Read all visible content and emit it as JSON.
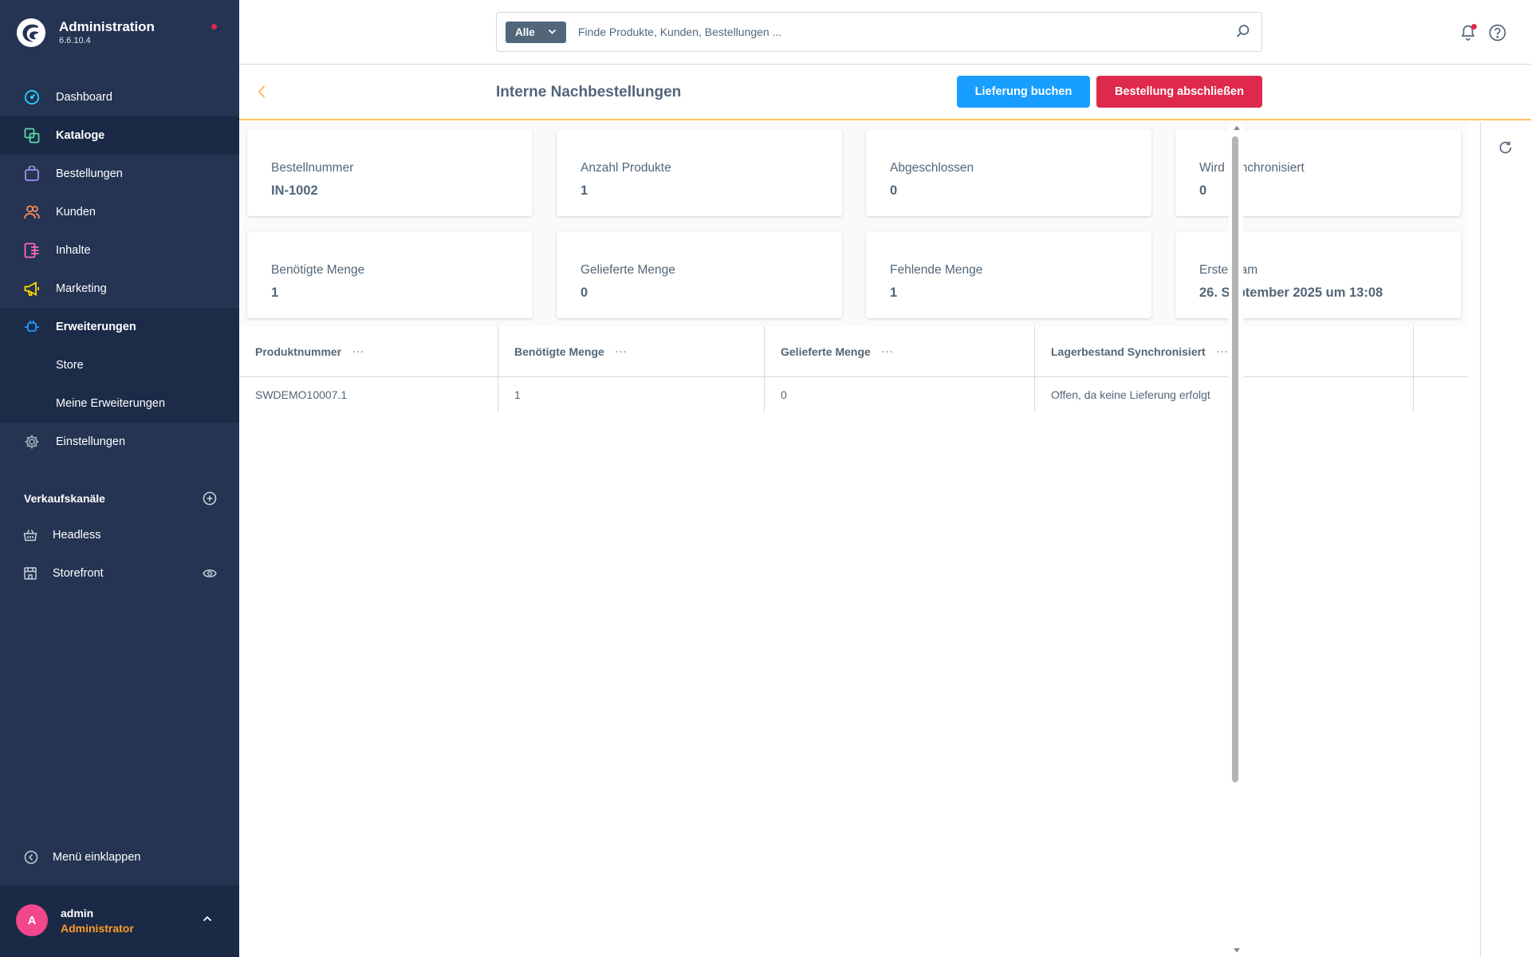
{
  "brand": {
    "title": "Administration",
    "version": "6.6.10.4"
  },
  "sidebar": {
    "items": [
      {
        "label": "Dashboard",
        "icon": "dashboard-icon",
        "color": "#26d1ff"
      },
      {
        "label": "Kataloge",
        "icon": "catalog-icon",
        "color": "#57d9a3"
      },
      {
        "label": "Bestellungen",
        "icon": "bag-icon",
        "color": "#a092f0"
      },
      {
        "label": "Kunden",
        "icon": "users-icon",
        "color": "#f88962"
      },
      {
        "label": "Inhalte",
        "icon": "content-icon",
        "color": "#ff68b4"
      },
      {
        "label": "Marketing",
        "icon": "megaphone-icon",
        "color": "#ffd700"
      },
      {
        "label": "Erweiterungen",
        "icon": "plug-icon",
        "color": "#189eff"
      },
      {
        "label": "Store"
      },
      {
        "label": "Meine Erweiterungen"
      },
      {
        "label": "Einstellungen",
        "icon": "gear-icon",
        "color": "#9aa8b5"
      }
    ],
    "channels_title": "Verkaufskanäle",
    "channels": [
      {
        "label": "Headless",
        "icon": "basket-icon"
      },
      {
        "label": "Storefront",
        "icon": "store-icon"
      }
    ],
    "collapse_label": "Menü einklappen",
    "user": {
      "initial": "A",
      "name": "admin",
      "role": "Administrator"
    }
  },
  "search": {
    "type_label": "Alle",
    "placeholder": "Finde Produkte, Kunden, Bestellungen ..."
  },
  "smartbar": {
    "title": "Interne Nachbestellungen",
    "primary_button": "Lieferung buchen",
    "danger_button": "Bestellung abschließen"
  },
  "stats": [
    {
      "label": "Bestellnummer",
      "value": "IN-1002"
    },
    {
      "label": "Anzahl Produkte",
      "value": "1"
    },
    {
      "label": "Abgeschlossen",
      "value": "0"
    },
    {
      "label": "Wird synchronisiert",
      "value": "0"
    },
    {
      "label": "Benötigte Menge",
      "value": "1"
    },
    {
      "label": "Gelieferte Menge",
      "value": "0"
    },
    {
      "label": "Fehlende Menge",
      "value": "1"
    },
    {
      "label": "Erstellt am",
      "value": "26. September 2025 um 13:08"
    }
  ],
  "table": {
    "columns": [
      "Produktnummer",
      "Benötigte Menge",
      "Gelieferte Menge",
      "Lagerbestand Synchronisiert"
    ],
    "rows": [
      [
        "SWDEMO10007.1",
        "1",
        "0",
        "Offen, da keine Lieferung erfolgt"
      ]
    ]
  }
}
